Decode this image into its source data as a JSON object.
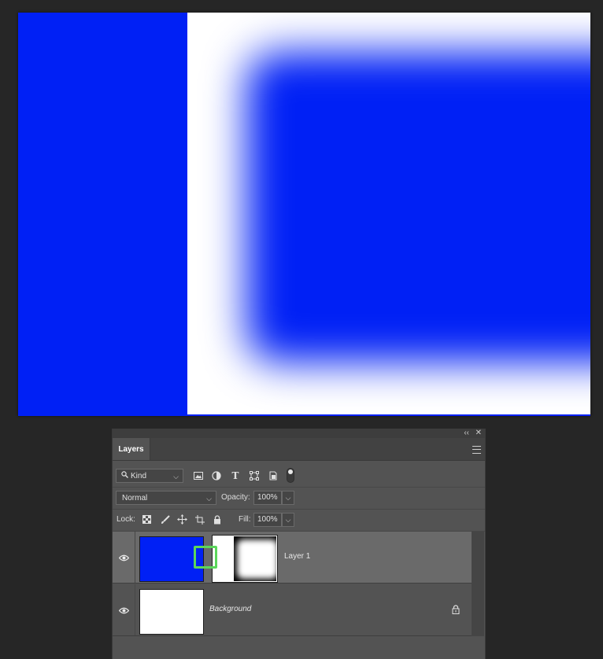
{
  "colors": {
    "canvas_blue": "#0020f5",
    "canvas_white": "#ffffff",
    "panel_bg": "#535353",
    "selected_row": "#6a6a6a",
    "highlight_green": "#5bd65b"
  },
  "panel": {
    "collapse_glyph": "‹‹",
    "close_glyph": "✕",
    "tab_label": "Layers",
    "menu_icon": "hamburger-icon"
  },
  "filter": {
    "kind_label": "Kind",
    "icons": [
      "pixel-layer-filter-icon",
      "adjustment-layer-filter-icon",
      "type-layer-filter-icon",
      "shape-layer-filter-icon",
      "smart-object-filter-icon"
    ],
    "type_glyph": "T"
  },
  "blend": {
    "mode": "Normal",
    "opacity_label": "Opacity:",
    "opacity_value": "100%"
  },
  "lock": {
    "label": "Lock:",
    "fill_label": "Fill:",
    "fill_value": "100%"
  },
  "layers": [
    {
      "name": "Layer 1",
      "selected": true,
      "has_mask": true
    },
    {
      "name": "Background",
      "selected": false,
      "locked": true
    }
  ]
}
